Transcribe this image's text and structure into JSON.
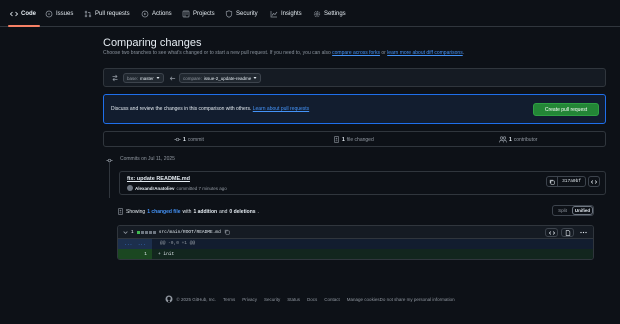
{
  "nav": {
    "items": [
      {
        "label": "Code",
        "icon": "code-icon"
      },
      {
        "label": "Issues",
        "icon": "issue-icon"
      },
      {
        "label": "Pull requests",
        "icon": "pull-request-icon"
      },
      {
        "label": "Actions",
        "icon": "actions-icon"
      },
      {
        "label": "Projects",
        "icon": "projects-icon"
      },
      {
        "label": "Security",
        "icon": "shield-icon"
      },
      {
        "label": "Insights",
        "icon": "graph-icon"
      },
      {
        "label": "Settings",
        "icon": "gear-icon"
      }
    ],
    "active": "Code"
  },
  "page": {
    "title": "Comparing changes",
    "subtitle_text": "Choose two branches to see what's changed or to start a new pull request. If you need to, you can also",
    "subtitle_link1": "compare across forks",
    "subtitle_or": "or",
    "subtitle_link2": "learn more about diff comparisons",
    "subtitle_end": "."
  },
  "compare": {
    "base_label": "base:",
    "base_value": "master",
    "compare_label": "compare:",
    "compare_value": "issue-2_update-readme"
  },
  "discuss": {
    "text": "Discuss and review the changes in this comparison with others.",
    "link": "Learn about pull requests",
    "button": "Create pull request"
  },
  "stats": {
    "commits_count": "1",
    "commits_label": "commit",
    "files_count": "1",
    "files_label": "file changed",
    "contributors_count": "1",
    "contributors_label": "contributor"
  },
  "commits": {
    "header": "Commits on Jul 11, 2025",
    "title": "fix: update README.md",
    "author": "AlexandrAnatoliev",
    "meta": "committed 7 minutes ago",
    "sha": "317a0bf"
  },
  "summary": {
    "showing": "Showing",
    "files": "1 changed file",
    "with": "with",
    "additions": "1 addition",
    "and": "and",
    "deletions": "0 deletions",
    "end": ".",
    "split": "Split",
    "unified": "Unified"
  },
  "diff": {
    "count": "1",
    "path": "src/main/ROOT/README.md",
    "hunk_expand": "...",
    "hunk_expand2": "...",
    "hunk": "@@ -0,0 +1 @@",
    "line_no": "1",
    "line_code": "+ init",
    "colors": {
      "add": "#3fb950",
      "neutral": "#6e7681"
    }
  },
  "footer": {
    "copyright": "© 2025 GitHub, Inc.",
    "links": [
      "Terms",
      "Privacy",
      "Security",
      "Status",
      "Docs",
      "Contact",
      "Manage cookies",
      "Do not share my personal information"
    ]
  },
  "colors": {
    "accent": "#4493f8",
    "green_button": "#238636",
    "nav_underline": "#f78166",
    "background": "#0d1117"
  }
}
